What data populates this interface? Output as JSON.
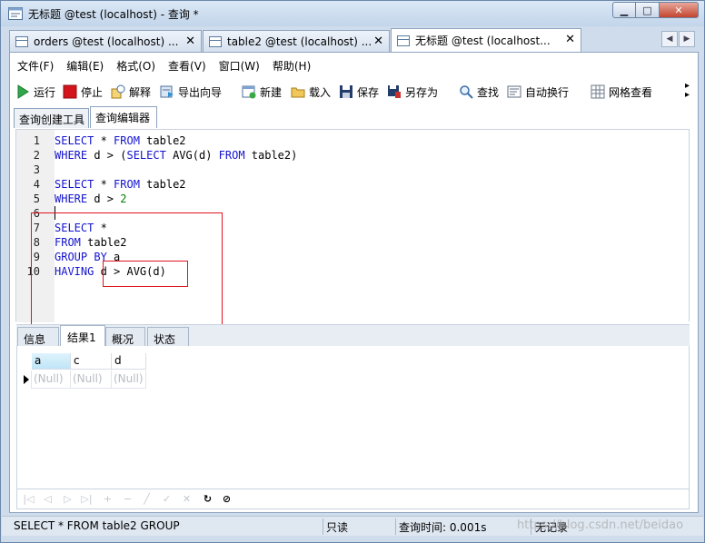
{
  "window": {
    "title": "无标题 @test (localhost) - 查询 *",
    "controls": {
      "minimize": "▁",
      "maximize": "□",
      "close": "✕"
    }
  },
  "doc_tabs": [
    {
      "label": "orders @test (localhost) ...",
      "close": "✕"
    },
    {
      "label": "table2 @test (localhost) ...",
      "close": "✕"
    },
    {
      "label": "无标题 @test (localhost...",
      "close": "✕"
    }
  ],
  "tab_nav": {
    "prev": "◀",
    "next": "▶"
  },
  "menu": [
    "文件(F)",
    "编辑(E)",
    "格式(O)",
    "查看(V)",
    "窗口(W)",
    "帮助(H)"
  ],
  "toolbar": {
    "run": "运行",
    "stop": "停止",
    "explain": "解释",
    "export_wizard": "导出向导",
    "new": "新建",
    "load": "载入",
    "save": "保存",
    "save_as": "另存为",
    "find": "查找",
    "word_wrap": "自动换行",
    "grid_view": "网格查看",
    "more": "▸\n▸"
  },
  "sub_tabs": [
    "查询创建工具",
    "查询编辑器"
  ],
  "editor": {
    "lines": [
      {
        "num": "1",
        "tokens": [
          [
            "kw",
            "SELECT"
          ],
          [
            "t",
            " * "
          ],
          [
            "kw",
            "FROM"
          ],
          [
            "t",
            " table2"
          ]
        ]
      },
      {
        "num": "2",
        "tokens": [
          [
            "kw",
            "WHERE"
          ],
          [
            "t",
            " d > ("
          ],
          [
            "kw",
            "SELECT"
          ],
          [
            "t",
            " AVG(d) "
          ],
          [
            "kw",
            "FROM"
          ],
          [
            "t",
            " table2)"
          ]
        ]
      },
      {
        "num": "3",
        "tokens": []
      },
      {
        "num": "4",
        "tokens": [
          [
            "kw",
            "SELECT"
          ],
          [
            "t",
            " * "
          ],
          [
            "kw",
            "FROM"
          ],
          [
            "t",
            " table2"
          ]
        ]
      },
      {
        "num": "5",
        "tokens": [
          [
            "kw",
            "WHERE"
          ],
          [
            "t",
            " d > "
          ],
          [
            "num",
            "2"
          ]
        ]
      },
      {
        "num": "6",
        "tokens": []
      },
      {
        "num": "7",
        "tokens": [
          [
            "kw",
            "SELECT"
          ],
          [
            "t",
            " *"
          ]
        ]
      },
      {
        "num": "8",
        "tokens": [
          [
            "kw",
            "FROM"
          ],
          [
            "t",
            " table2"
          ]
        ]
      },
      {
        "num": "9",
        "tokens": [
          [
            "kw",
            "GROUP BY"
          ],
          [
            "t",
            " a"
          ]
        ]
      },
      {
        "num": "10",
        "tokens": [
          [
            "kw",
            "HAVING"
          ],
          [
            "t",
            " d > AVG(d)"
          ]
        ]
      }
    ]
  },
  "result_tabs": [
    "信息",
    "结果1",
    "概况",
    "状态"
  ],
  "grid": {
    "columns": [
      "a",
      "c",
      "d"
    ],
    "rows": [
      [
        "(Null)",
        "(Null)",
        "(Null)"
      ]
    ]
  },
  "navbar": {
    "first": "|◁",
    "prev": "◁",
    "next": "▷",
    "last": "▷|",
    "add": "+",
    "delete": "−",
    "edit": "╱",
    "apply": "✓",
    "cancel": "✕",
    "refresh": "↻",
    "stop": "⊘"
  },
  "status": {
    "sql": "SELECT * FROM table2 GROUP",
    "readonly": "只读",
    "query_time": "查询时间: 0.001s",
    "records": "无记录"
  },
  "watermark": "https://blog.csdn.net/beidao",
  "colors": {
    "keyword": "#1414cf",
    "number": "#008000",
    "highlight_box": "#e0141e"
  }
}
